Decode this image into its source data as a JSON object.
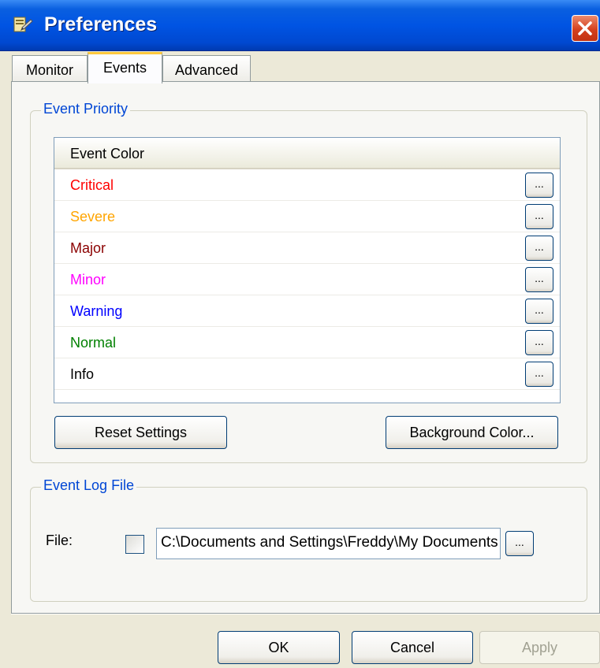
{
  "window": {
    "title": "Preferences"
  },
  "tabs": [
    {
      "label": "Monitor"
    },
    {
      "label": "Events"
    },
    {
      "label": "Advanced"
    }
  ],
  "active_tab": "Events",
  "event_priority": {
    "group_label": "Event Priority",
    "column_header": "Event Color",
    "rows": [
      {
        "label": "Critical",
        "color": "#ff0000"
      },
      {
        "label": "Severe",
        "color": "#ffa500"
      },
      {
        "label": "Major",
        "color": "#8b0000"
      },
      {
        "label": "Minor",
        "color": "#ff00ff"
      },
      {
        "label": "Warning",
        "color": "#0000ff"
      },
      {
        "label": "Normal",
        "color": "#008000"
      },
      {
        "label": "Info",
        "color": "#000000"
      }
    ],
    "row_button_label": "...",
    "reset_button": "Reset Settings",
    "background_button": "Background Color..."
  },
  "event_log": {
    "group_label": "Event Log File",
    "file_label": "File:",
    "file_checked": false,
    "file_path": "C:\\Documents and Settings\\Freddy\\My Documents",
    "browse_label": "..."
  },
  "footer": {
    "ok": "OK",
    "cancel": "Cancel",
    "apply": "Apply"
  }
}
